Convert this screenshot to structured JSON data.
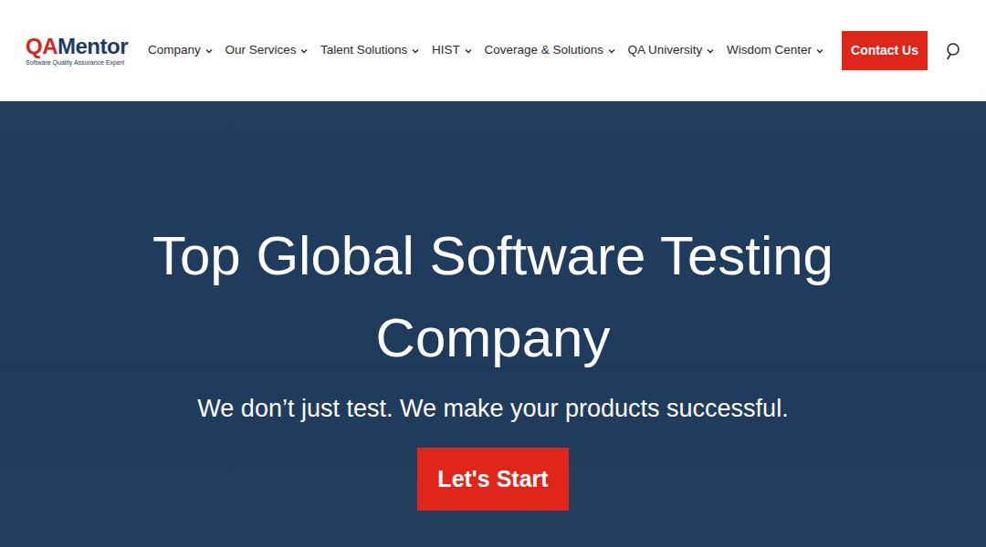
{
  "logo": {
    "mark": "QA",
    "name": "Mentor",
    "tagline": "Software Quality Assurance Expert"
  },
  "nav": {
    "items": [
      {
        "label": "Company",
        "has_dropdown": true
      },
      {
        "label": "Our Services",
        "has_dropdown": true
      },
      {
        "label": "Talent Solutions",
        "has_dropdown": true
      },
      {
        "label": "HIST",
        "has_dropdown": true
      },
      {
        "label": "Coverage & Solutions",
        "has_dropdown": true
      },
      {
        "label": "QA University",
        "has_dropdown": true
      },
      {
        "label": "Wisdom Center",
        "has_dropdown": true
      }
    ]
  },
  "contact_button": "Contact Us",
  "hero": {
    "title": "Top Global Software Testing Company",
    "subtitle": "We don’t just test. We make your products successful.",
    "button": "Let's Start"
  }
}
